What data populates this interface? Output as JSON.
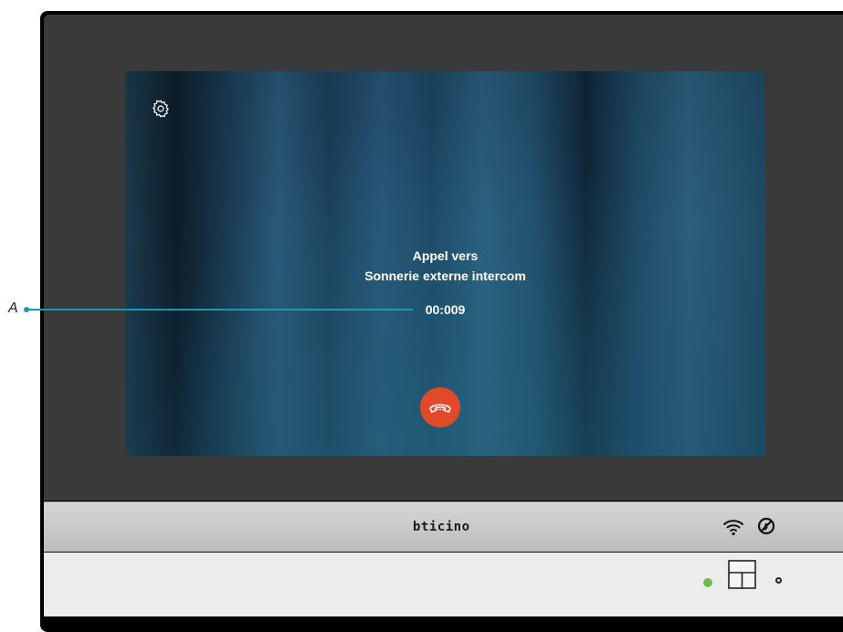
{
  "call": {
    "line1": "Appel vers",
    "line2": "Sonnerie externe intercom",
    "timer": "00:009"
  },
  "annotation": {
    "label": "A"
  },
  "brand": {
    "logo_text": "bticino"
  },
  "icons": {
    "settings": "gear-icon",
    "hangup": "phone-hangup-icon",
    "wifi": "wifi-icon",
    "dnd": "do-not-disturb-icon",
    "keypad": "key-icon"
  },
  "colors": {
    "hangup": "#e04a2b",
    "annotation_line": "#1a9bb0",
    "status_led": "#6cc04a"
  }
}
